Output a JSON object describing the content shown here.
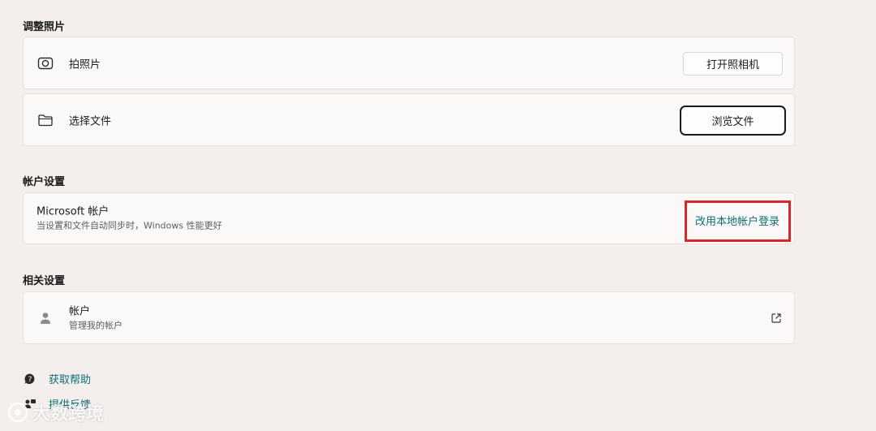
{
  "sections": {
    "adjust_photo": "调整照片",
    "account_settings": "帐户设置",
    "related_settings": "相关设置"
  },
  "photo_rows": {
    "take_photo": {
      "label": "拍照片",
      "button": "打开照相机",
      "icon": "camera-icon"
    },
    "choose_file": {
      "label": "选择文件",
      "button": "浏览文件",
      "icon": "folder-icon"
    }
  },
  "microsoft_account": {
    "title": "Microsoft 帐户",
    "subtitle": "当设置和文件自动同步时，Windows 性能更好",
    "action": "改用本地帐户登录"
  },
  "accounts_row": {
    "title": "帐户",
    "subtitle": "管理我的帐户",
    "icon": "person-icon",
    "trailing_icon": "external-link-icon"
  },
  "links": {
    "get_help": "获取帮助",
    "give_feedback": "提供反馈"
  },
  "watermark": "大数跨境",
  "colors": {
    "background": "#f4efec",
    "card": "#fbf9f8",
    "link": "#0e6e76",
    "highlight": "#d8262b"
  }
}
